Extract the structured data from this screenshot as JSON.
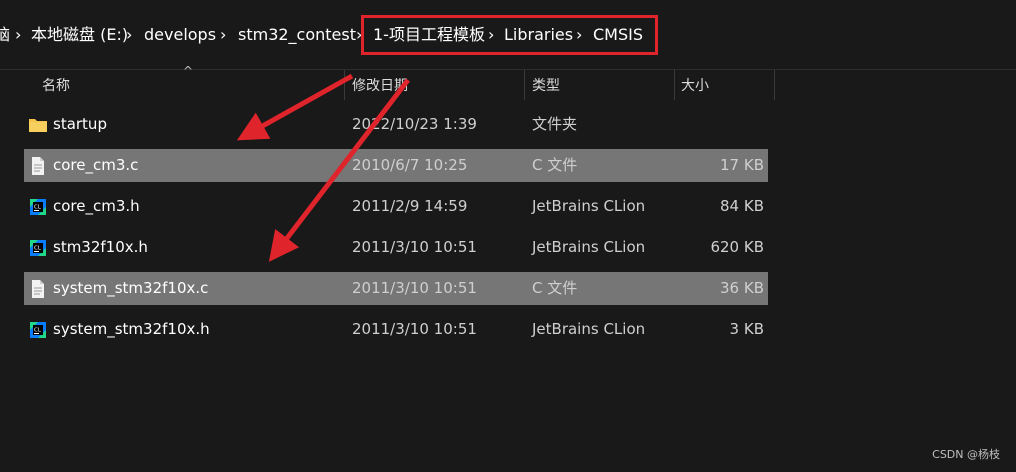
{
  "breadcrumbs": {
    "partial": "脑",
    "drive": "本地磁盘 (E:)",
    "f1": "develops",
    "f2": "stm32_contest",
    "f3": "1-项目工程模板",
    "f4": "Libraries",
    "f5": "CMSIS",
    "separator": "›"
  },
  "columns": {
    "name": "名称",
    "modified": "修改日期",
    "type": "类型",
    "size": "大小",
    "sort_indicator": "^"
  },
  "files": [
    {
      "name": "startup",
      "modified": "2022/10/23 1:39",
      "type": "文件夹",
      "size": "",
      "icon": "folder-icon",
      "selected": false
    },
    {
      "name": "core_cm3.c",
      "modified": "2010/6/7 10:25",
      "type": "C 文件",
      "size": "17 KB",
      "icon": "c-file-icon",
      "selected": true
    },
    {
      "name": "core_cm3.h",
      "modified": "2011/2/9 14:59",
      "type": "JetBrains CLion",
      "size": "84 KB",
      "icon": "clion-icon",
      "selected": false
    },
    {
      "name": "stm32f10x.h",
      "modified": "2011/3/10 10:51",
      "type": "JetBrains CLion",
      "size": "620 KB",
      "icon": "clion-icon",
      "selected": false
    },
    {
      "name": "system_stm32f10x.c",
      "modified": "2011/3/10 10:51",
      "type": "C 文件",
      "size": "36 KB",
      "icon": "c-file-icon",
      "selected": true
    },
    {
      "name": "system_stm32f10x.h",
      "modified": "2011/3/10 10:51",
      "type": "JetBrains CLion",
      "size": "3 KB",
      "icon": "clion-icon",
      "selected": false
    }
  ],
  "watermark": "CSDN @杨枝",
  "colors": {
    "background": "#191919",
    "selected_row": "#767676",
    "annotation_red": "#e0242b",
    "folder": "#f3c34b",
    "clion_green": "#21d789",
    "clion_blue": "#087cfa"
  }
}
